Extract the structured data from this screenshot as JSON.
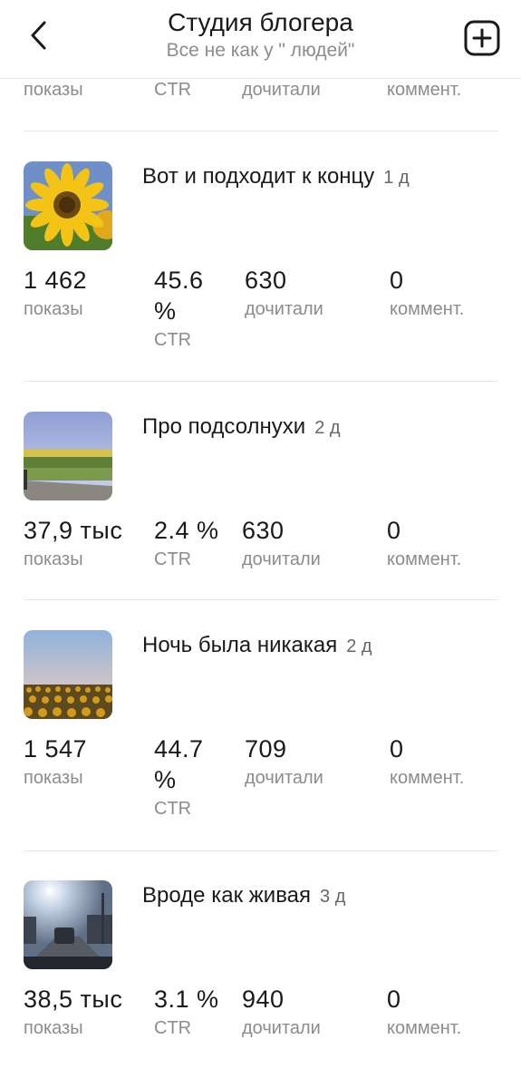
{
  "header": {
    "title": "Студия блогера",
    "subtitle": "Все не как у \" людей\""
  },
  "partial_labels": [
    "показы",
    "CTR",
    "дочитали",
    "коммент."
  ],
  "posts": [
    {
      "title": "Вот и подходит к концу",
      "age": "1 д",
      "thumb": "sunflower-closeup",
      "stats": {
        "views": "1 462",
        "ctr": "45.6 %",
        "reads": "630",
        "comments": "0"
      },
      "labels": {
        "views": "показы",
        "ctr": "CTR",
        "reads": "дочитали",
        "comments": "коммент."
      }
    },
    {
      "title": "Про подсолнухи",
      "age": "2 д",
      "thumb": "sunflower-field-road",
      "stats": {
        "views": "37,9 тыс",
        "ctr": "2.4 %",
        "reads": "630",
        "comments": "0"
      },
      "labels": {
        "views": "показы",
        "ctr": "CTR",
        "reads": "дочитали",
        "comments": "коммент."
      }
    },
    {
      "title": "Ночь была никакая",
      "age": "2 д",
      "thumb": "sunflower-field-dusk",
      "stats": {
        "views": "1 547",
        "ctr": "44.7 %",
        "reads": "709",
        "comments": "0"
      },
      "labels": {
        "views": "показы",
        "ctr": "CTR",
        "reads": "дочитали",
        "comments": "коммент."
      }
    },
    {
      "title": "Вроде как живая",
      "age": "3 д",
      "thumb": "road-through-windshield",
      "stats": {
        "views": "38,5 тыс",
        "ctr": "3.1 %",
        "reads": "940",
        "comments": "0"
      },
      "labels": {
        "views": "показы",
        "ctr": "CTR",
        "reads": "дочитали",
        "comments": "коммент."
      }
    }
  ],
  "icons": {
    "back": "chevron-left-icon",
    "add": "plus-square-icon"
  },
  "colors": {
    "text": "#1a1a1a",
    "muted": "#8c8c8c",
    "divider": "#e6e6e6"
  }
}
